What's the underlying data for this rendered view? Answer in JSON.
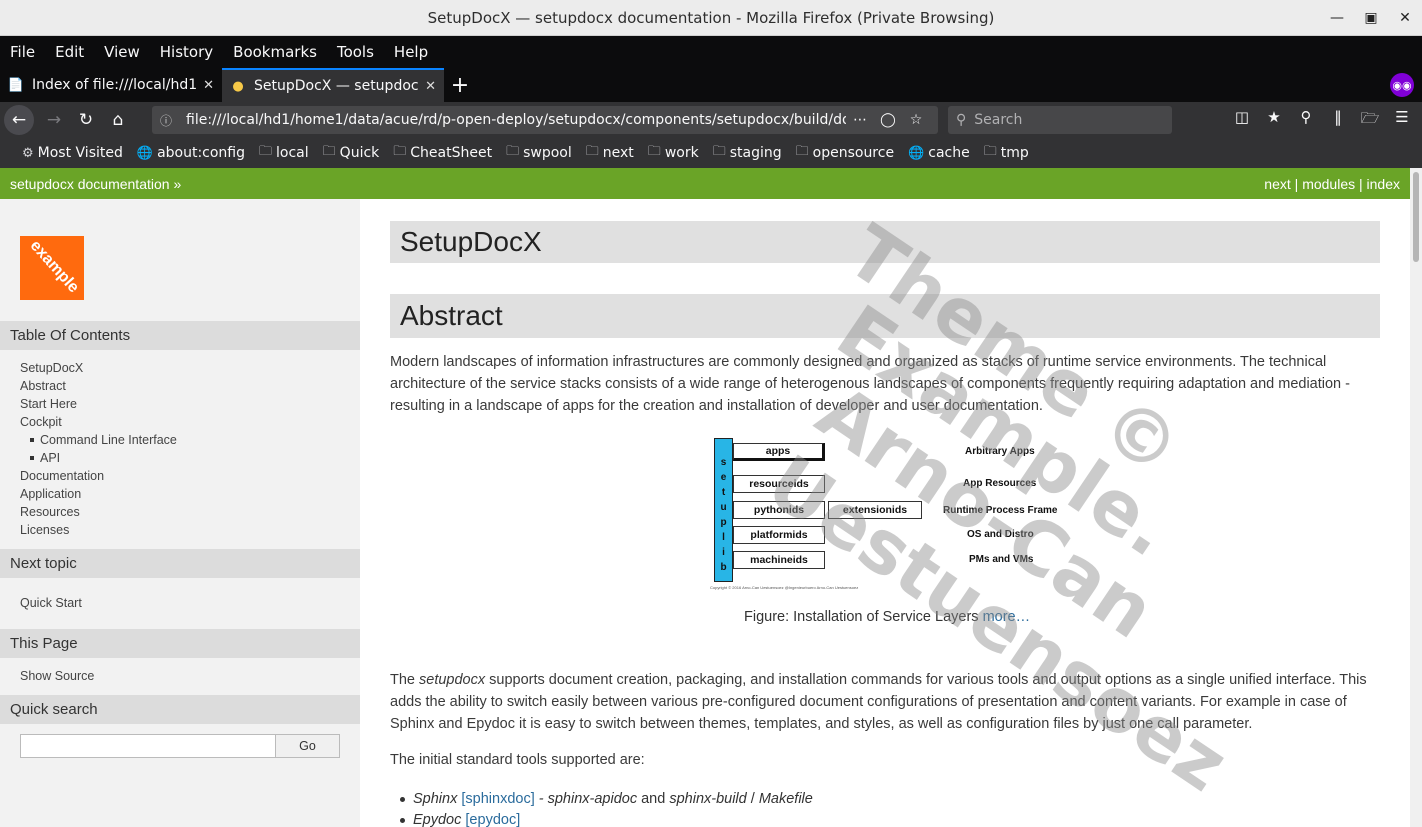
{
  "window": {
    "title": "SetupDocX — setupdocx documentation - Mozilla Firefox (Private Browsing)",
    "controls": [
      "minimize",
      "maximize",
      "close"
    ]
  },
  "menu": [
    "File",
    "Edit",
    "View",
    "History",
    "Bookmarks",
    "Tools",
    "Help"
  ],
  "tabs": [
    {
      "label": "Index of file:///local/hd1/h",
      "icon": "document-icon",
      "active": false
    },
    {
      "label": "SetupDocX — setupdocx",
      "icon": "python-icon",
      "active": true
    }
  ],
  "url": "file:///local/hd1/home1/data/acue/rd/p-open-deploy/setupdocx/components/setupdocx/build/doc/n",
  "search_placeholder": "Search",
  "bookmarks": [
    {
      "label": "Most Visited",
      "icon": "gear-icon"
    },
    {
      "label": "about:config",
      "icon": "globe-icon"
    },
    {
      "label": "local",
      "icon": "folder-icon"
    },
    {
      "label": "Quick",
      "icon": "folder-icon"
    },
    {
      "label": "CheatSheet",
      "icon": "folder-icon"
    },
    {
      "label": "swpool",
      "icon": "folder-icon"
    },
    {
      "label": "next",
      "icon": "folder-icon"
    },
    {
      "label": "work",
      "icon": "folder-icon"
    },
    {
      "label": "staging",
      "icon": "folder-icon"
    },
    {
      "label": "opensource",
      "icon": "folder-icon"
    },
    {
      "label": "cache",
      "icon": "globe-icon"
    },
    {
      "label": "tmp",
      "icon": "folder-icon"
    }
  ],
  "related": {
    "left": "setupdocx documentation »",
    "next": "next",
    "modules": "modules",
    "index": "index"
  },
  "sidebar": {
    "logo_text": "example",
    "toc_heading": "Table Of Contents",
    "toc": [
      "SetupDocX",
      "Abstract",
      "Start Here",
      "Cockpit",
      "Command Line Interface",
      "API",
      "Documentation",
      "Application",
      "Resources",
      "Licenses"
    ],
    "next_heading": "Next topic",
    "next_link": "Quick Start",
    "this_page_heading": "This Page",
    "show_source": "Show Source",
    "quick_search_heading": "Quick search",
    "go_button": "Go"
  },
  "content": {
    "title": "SetupDocX",
    "abstract_heading": "Abstract",
    "para1": "Modern landscapes of information infrastructures are commonly designed and organized as stacks of runtime service environments. The technical architecture of the service stacks consists of a wide range of heterogenous landscapes of components frequently requiring adaptation and mediation - resulting in a landscape of apps for the creation and installation of developer and user documentation.",
    "figure": {
      "bar_letters": [
        "s",
        "e",
        "t",
        "u",
        "p",
        "l",
        "i",
        "b"
      ],
      "boxes": [
        "apps",
        "resourceids",
        "pythonids",
        "extensionids",
        "platformids",
        "machineids"
      ],
      "labels": [
        "Arbitrary Apps",
        "App Resources",
        "Runtime Process Frame",
        "OS and Distro",
        "PMs and VMs"
      ],
      "copyright": "Copyright © 2016 Arno-Can Uestuensoez @Ingenieurbuero Arno-Can Uestuensoez"
    },
    "caption": "Figure: Installation of Service Layers",
    "caption_link": "more…",
    "para2_pre": "The ",
    "para2_em": "setupdocx",
    "para2_post": " supports document creation, packaging, and installation commands for various tools and output options as a single unified interface. This adds the ability to switch easily between various pre-configured document configurations of presentation and content variants. For example in case of Sphinx and Epydoc it is easy to switch between themes, templates, and styles, as well as configuration files by just one call parameter.",
    "para3": "The initial standard tools supported are:",
    "list": [
      {
        "em": "Sphinx",
        "link": "[sphinxdoc]",
        "rest_em1": " - sphinx-apidoc",
        "rest": " and ",
        "rest_em2": "sphinx-build",
        "rest2": " / ",
        "rest_em3": "Makefile"
      },
      {
        "em": "Epydoc",
        "link": "[epydoc]"
      }
    ]
  },
  "watermark": [
    "Theme ©",
    "Example.",
    "Arno-Can",
    "Uestuensoez"
  ]
}
